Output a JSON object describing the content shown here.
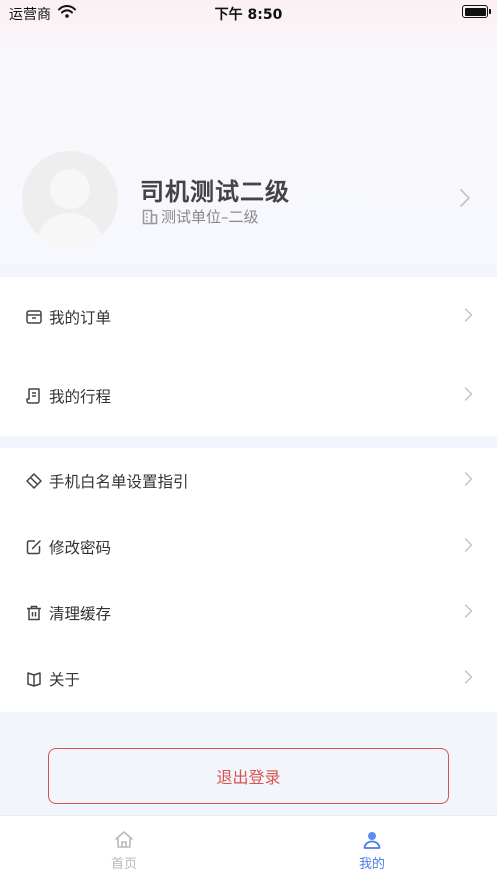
{
  "status_bar": {
    "carrier": "运营商",
    "time": "下午 8:50"
  },
  "profile": {
    "name": "司机测试二级",
    "org": "测试单位–二级"
  },
  "menu_group_1": [
    {
      "label": "我的订单",
      "icon": "order-box-icon"
    },
    {
      "label": "我的行程",
      "icon": "itinerary-scroll-icon"
    }
  ],
  "menu_group_2": [
    {
      "label": "手机白名单设置指引",
      "icon": "tag-icon"
    },
    {
      "label": "修改密码",
      "icon": "edit-icon"
    },
    {
      "label": "清理缓存",
      "icon": "trash-icon"
    },
    {
      "label": "关于",
      "icon": "book-icon"
    }
  ],
  "logout_label": "退出登录",
  "tabs": [
    {
      "label": "首页",
      "icon": "home-icon",
      "active": false
    },
    {
      "label": "我的",
      "icon": "person-icon",
      "active": true
    }
  ],
  "colors": {
    "accent": "#4a7de6",
    "danger": "#d9534f",
    "background": "#f3f5fc"
  }
}
